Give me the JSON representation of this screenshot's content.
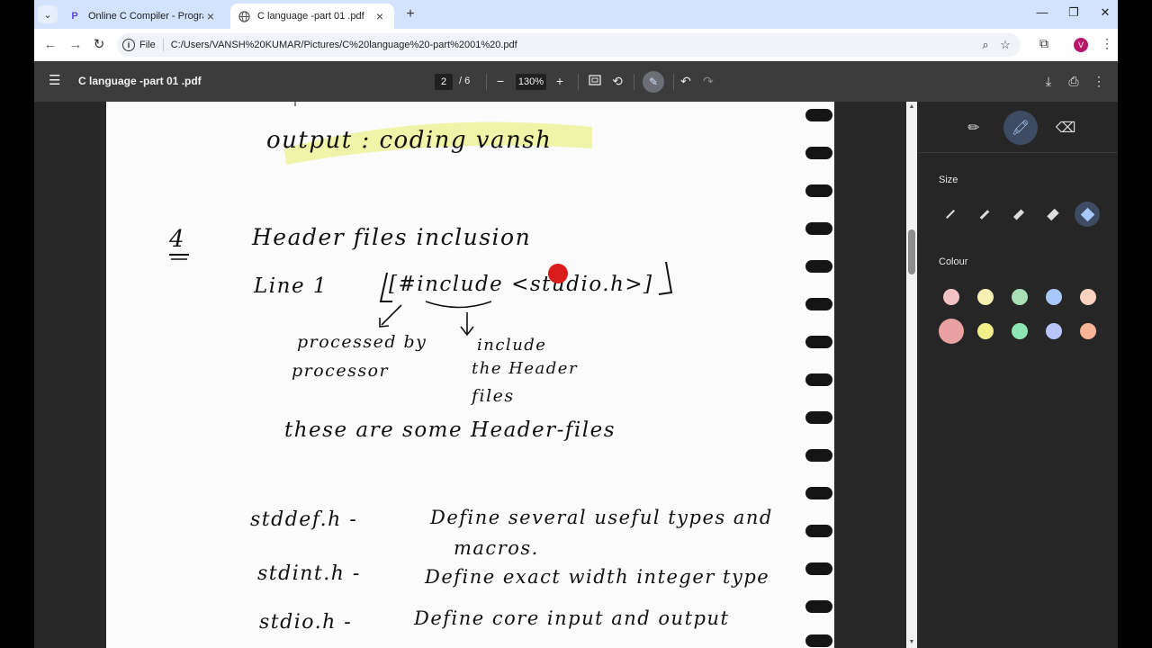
{
  "browser": {
    "tabs": [
      {
        "title": "Online C Compiler - Programiz",
        "favicon": "programiz-icon",
        "active": false
      },
      {
        "title": "C language -part 01 .pdf",
        "favicon": "globe-icon",
        "active": true
      }
    ],
    "address": {
      "scheme_chip": "File",
      "url": "C:/Users/VANSH%20KUMAR/Pictures/C%20language%20-part%2001%20.pdf"
    },
    "profile_initial": "V"
  },
  "pdf_toolbar": {
    "title": "C language -part 01 .pdf",
    "page_current": "2",
    "page_total": "/ 6",
    "zoom": "130%"
  },
  "document": {
    "lines": [
      "output :   coding vansh",
      "4",
      "Header files inclusion",
      "Line 1",
      "[#include <studio.h>]",
      "processed by",
      "processor",
      "include",
      "the Header",
      "files",
      "these are some Header-files",
      "stddef.h -",
      "Define several useful types and",
      "macros.",
      "stdint.h -",
      "Define exact width integer type",
      "stdio.h -",
      "Define core input and output"
    ],
    "highlight_color": "#eef3a0"
  },
  "side_panel": {
    "size_label": "Size",
    "colour_label": "Colour",
    "accent": "#a8c7fa",
    "colours": [
      "#f4c2c2",
      "#f6f0b3",
      "#a8dfb4",
      "#a8c7fa",
      "#f9d3c0",
      "#e8a0a0",
      "#f2f08a",
      "#8fe6b4",
      "#b8c4fb",
      "#f7b595"
    ]
  }
}
